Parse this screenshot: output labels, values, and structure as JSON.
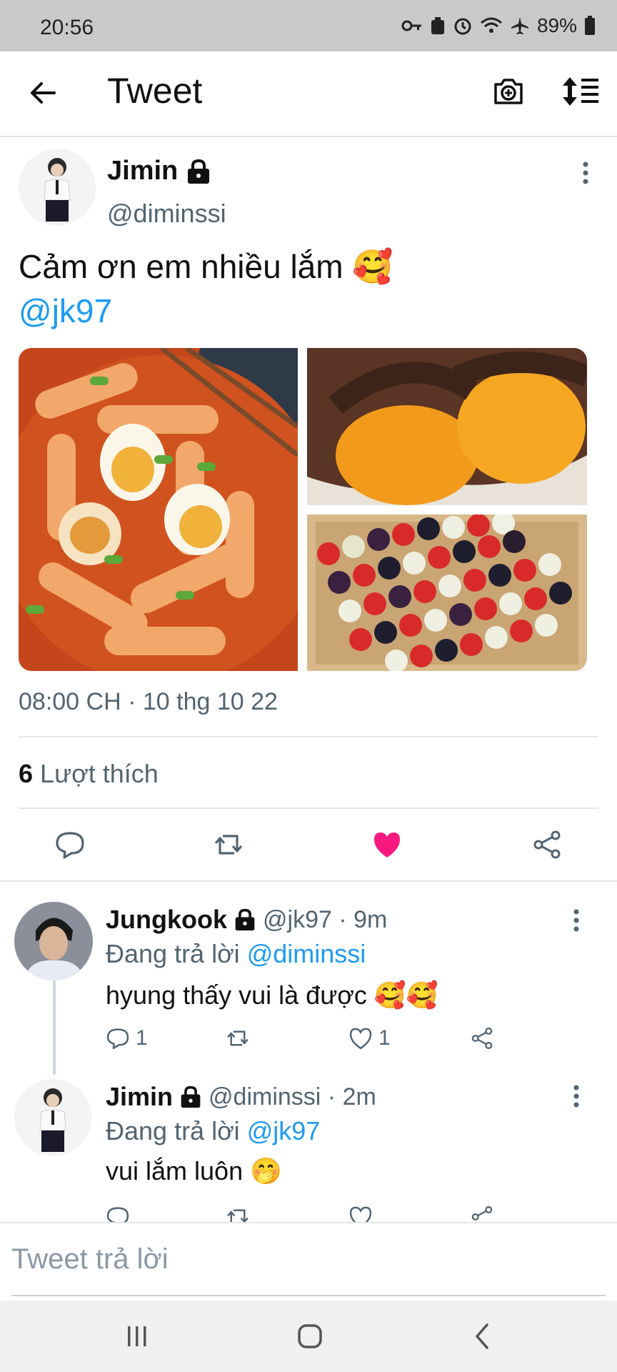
{
  "status_bar": {
    "time": "20:56",
    "battery": "89%"
  },
  "header": {
    "title": "Tweet"
  },
  "tweet": {
    "author_name": "Jimin",
    "author_handle": "@diminssi",
    "text_line1": "Cảm ơn em nhiều lắm",
    "text_emoji": "🥰",
    "mention": "@jk97",
    "timestamp": "08:00 CH · 10 thg 10 22",
    "likes_count": "6",
    "likes_label": "Lượt thích"
  },
  "replies": [
    {
      "author_name": "Jungkook",
      "handle_time": "@jk97 · 9m",
      "replying_prefix": "Đang trả lời",
      "replying_to": "@diminssi",
      "text": "hyung thấy vui là được",
      "emoji": "🥰🥰",
      "reply_count": "1",
      "like_count": "1"
    },
    {
      "author_name": "Jimin",
      "handle_time": "@diminssi · 2m",
      "replying_prefix": "Đang trả lời",
      "replying_to": "@jk97",
      "text": "vui lắm luôn",
      "emoji": "🤭"
    }
  ],
  "reply_bar": {
    "placeholder": "Tweet trả lời"
  },
  "colors": {
    "accent": "#1d9bf0",
    "liked": "#f91880",
    "text": "#0f1419",
    "muted": "#536471"
  }
}
